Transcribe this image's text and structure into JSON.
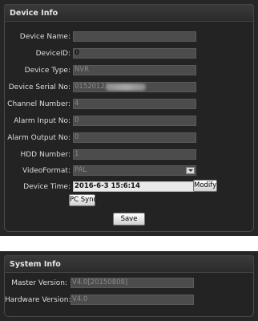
{
  "device_info": {
    "title": "Device Info",
    "fields": {
      "device_name": {
        "label": "Device Name:",
        "value": ""
      },
      "device_id": {
        "label": "DeviceID:",
        "value": "0"
      },
      "device_type": {
        "label": "Device Type:",
        "value": "NVR"
      },
      "device_serial_no": {
        "label": "Device Serial No:",
        "value": "01520123c"
      },
      "channel_number": {
        "label": "Channel Number:",
        "value": "4"
      },
      "alarm_input_no": {
        "label": "Alarm Input No:",
        "value": "0"
      },
      "alarm_output_no": {
        "label": "Alarm Output No:",
        "value": "0"
      },
      "hdd_number": {
        "label": "HDD Number:",
        "value": "1"
      },
      "video_format": {
        "label": "VideoFormat:",
        "value": "PAL"
      },
      "device_time": {
        "label": "Device Time:",
        "value": "2016-6-3 15:6:14"
      }
    },
    "modify_label": "Modify",
    "pc_sync_label": "PC Sync",
    "save_label": "Save"
  },
  "system_info": {
    "title": "System Info",
    "fields": {
      "master_version": {
        "label": "Master Version:",
        "value": "V4.0[20150808]"
      },
      "hardware_version": {
        "label": "Hardware Version:",
        "value": "V4.0"
      }
    }
  },
  "colors": {
    "panel_bg": "#262626",
    "field_bg": "#4c4c4c",
    "editable_field_bg": "#e9e9e9",
    "label_text": "#dedede"
  },
  "icons": {
    "select_arrow": "chevron-down-icon"
  }
}
